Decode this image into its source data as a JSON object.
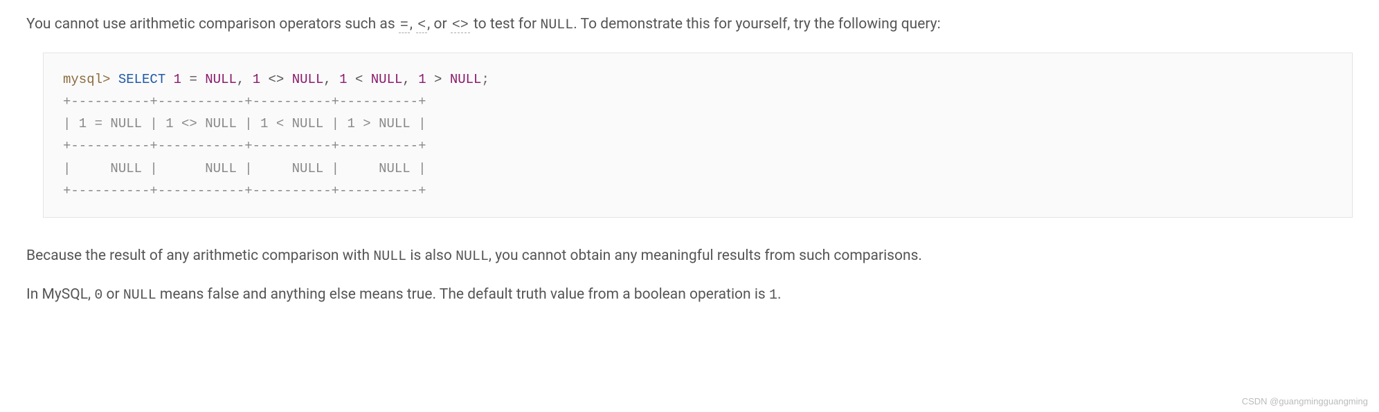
{
  "para1": {
    "t1": "You cannot use arithmetic comparison operators such as ",
    "sym_eq": "=",
    "t2": ", ",
    "sym_lt": "<",
    "t3": ", or ",
    "sym_ne": "<>",
    "t4": " to test for ",
    "null1": "NULL",
    "t5": ". To demonstrate this for yourself, try the following query:"
  },
  "code": {
    "prompt": "mysql>",
    "sp1": " ",
    "select": "SELECT",
    "sp2": " ",
    "n1": "1",
    "sp3": " ",
    "op_eq": "=",
    "sp4": " ",
    "null_a": "NULL",
    "comma1": ",",
    "sp5": " ",
    "n2": "1",
    "sp6": " ",
    "op_ne": "<>",
    "sp7": " ",
    "null_b": "NULL",
    "comma2": ",",
    "sp8": " ",
    "n3": "1",
    "sp9": " ",
    "op_lt": "<",
    "sp10": " ",
    "null_c": "NULL",
    "comma3": ",",
    "sp11": " ",
    "n4": "1",
    "sp12": " ",
    "op_gt": ">",
    "sp13": " ",
    "null_d": "NULL",
    "semi": ";",
    "out1": "+----------+-----------+----------+----------+",
    "out2": "| 1 = NULL | 1 <> NULL | 1 < NULL | 1 > NULL |",
    "out3": "+----------+-----------+----------+----------+",
    "out4": "|     NULL |      NULL |     NULL |     NULL |",
    "out5": "+----------+-----------+----------+----------+"
  },
  "para2": {
    "t1": "Because the result of any arithmetic comparison with ",
    "null1": "NULL",
    "t2": " is also ",
    "null2": "NULL",
    "t3": ", you cannot obtain any meaningful results from such comparisons."
  },
  "para3": {
    "t1": "In MySQL, ",
    "zero": "0",
    "t2": " or ",
    "null1": "NULL",
    "t3": " means false and anything else means true. The default truth value from a boolean operation is ",
    "one": "1",
    "t4": "."
  },
  "watermark": "CSDN @guangmingguangming"
}
